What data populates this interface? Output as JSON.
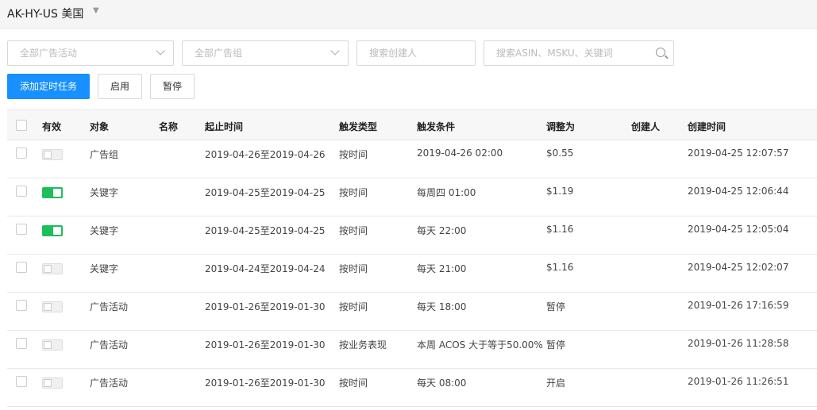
{
  "header": {
    "store_name": "AK-HY-US 美国"
  },
  "filters": {
    "campaign_placeholder": "全部广告活动",
    "adgroup_placeholder": "全部广告组",
    "creator_placeholder": "搜索创建人",
    "keyword_placeholder": "搜索ASIN、MSKU、关键词"
  },
  "toolbar": {
    "add_label": "添加定时任务",
    "enable_label": "启用",
    "pause_label": "暂停"
  },
  "columns": {
    "valid": "有效",
    "object": "对象",
    "name": "名称",
    "period": "起止时间",
    "trigger_type": "触发类型",
    "trigger_condition": "触发条件",
    "adjust_to": "调整为",
    "creator": "创建人",
    "created_at": "创建时间"
  },
  "rows": [
    {
      "enabled": false,
      "object": "广告组",
      "name": "",
      "period": "2019-04-26至2019-04-26",
      "trigger_type": "按时间",
      "trigger_condition": "2019-04-26 02:00",
      "adjust_to": "$0.55",
      "creator": "",
      "created_at": "2019-04-25 12:07:57"
    },
    {
      "enabled": true,
      "object": "关键字",
      "name": "",
      "period": "2019-04-25至2019-04-25",
      "trigger_type": "按时间",
      "trigger_condition": "每周四 01:00",
      "adjust_to": "$1.19",
      "creator": "",
      "created_at": "2019-04-25 12:06:44"
    },
    {
      "enabled": true,
      "object": "关键字",
      "name": "",
      "period": "2019-04-25至2019-04-25",
      "trigger_type": "按时间",
      "trigger_condition": "每天 22:00",
      "adjust_to": "$1.16",
      "creator": "",
      "created_at": "2019-04-25 12:05:04"
    },
    {
      "enabled": false,
      "object": "关键字",
      "name": "",
      "period": "2019-04-24至2019-04-24",
      "trigger_type": "按时间",
      "trigger_condition": "每天 21:00",
      "adjust_to": "$1.16",
      "creator": "",
      "created_at": "2019-04-25 12:02:07"
    },
    {
      "enabled": false,
      "object": "广告活动",
      "name": "",
      "period": "2019-01-26至2019-01-30",
      "trigger_type": "按时间",
      "trigger_condition": "每天 18:00",
      "adjust_to": "暂停",
      "creator": "",
      "created_at": "2019-01-26 17:16:59"
    },
    {
      "enabled": false,
      "object": "广告活动",
      "name": "",
      "period": "2019-01-26至2019-01-30",
      "trigger_type": "按业务表现",
      "trigger_condition": "本周 ACOS 大于等于50.00%",
      "adjust_to": "暂停",
      "creator": "",
      "created_at": "2019-01-26 11:28:58"
    },
    {
      "enabled": false,
      "object": "广告活动",
      "name": "",
      "period": "2019-01-26至2019-01-30",
      "trigger_type": "按时间",
      "trigger_condition": "每天 08:00",
      "adjust_to": "开启",
      "creator": "",
      "created_at": "2019-01-26 11:26:51"
    }
  ]
}
